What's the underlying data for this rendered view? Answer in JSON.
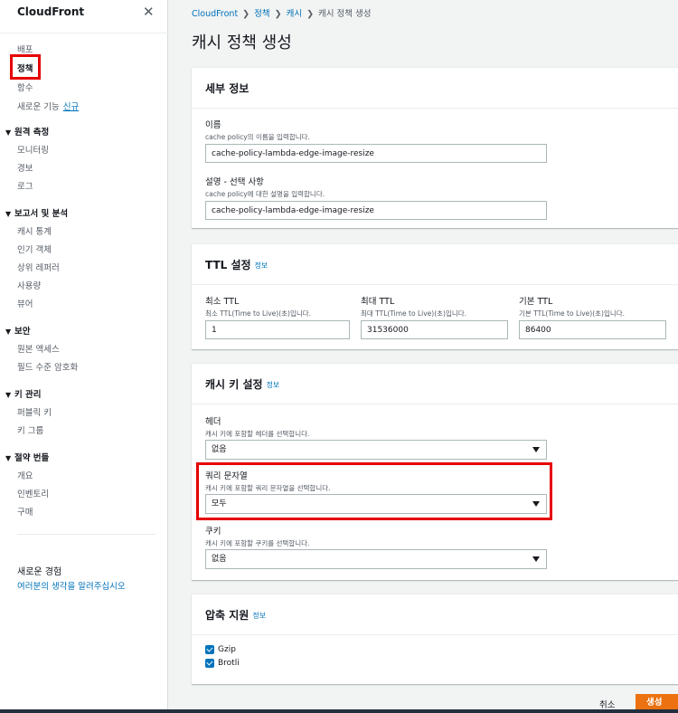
{
  "sidebar": {
    "title": "CloudFront",
    "close_icon": "close-icon",
    "items_top": [
      {
        "label": "배포",
        "active": false
      },
      {
        "label": "정책",
        "active": true
      },
      {
        "label": "함수",
        "active": false
      }
    ],
    "new_features": {
      "label": "새로운 기능",
      "badge": "신규"
    },
    "sections": [
      {
        "title": "원격 측정",
        "items": [
          "모니터링",
          "경보",
          "로그"
        ]
      },
      {
        "title": "보고서 및 분석",
        "items": [
          "캐시 통계",
          "인기 객체",
          "상위 레퍼러",
          "사용량",
          "뷰어"
        ]
      },
      {
        "title": "보안",
        "items": [
          "원본 액세스",
          "필드 수준 암호화"
        ]
      },
      {
        "title": "키 관리",
        "items": [
          "퍼블릭 키",
          "키 그룹"
        ]
      },
      {
        "title": "절약 번들",
        "items": [
          "개요",
          "인벤토리",
          "구매"
        ]
      }
    ],
    "feedback": {
      "title": "새로운 경험",
      "link": "여러분의 생각을 알려주십시오"
    }
  },
  "breadcrumb": [
    "CloudFront",
    "정책",
    "캐시",
    "캐시 정책 생성"
  ],
  "page_title": "캐시 정책 생성",
  "details": {
    "title": "세부 정보",
    "name_label": "이름",
    "name_desc": "cache policy의 이름을 입력합니다.",
    "name_value": "cache-policy-lambda-edge-image-resize",
    "desc_label": "설명 - 선택 사항",
    "desc_desc": "cache policy에 대한 설명을 입력합니다.",
    "desc_value": "cache-policy-lambda-edge-image-resize"
  },
  "ttl": {
    "title": "TTL 설정",
    "info": "정보",
    "min_label": "최소 TTL",
    "min_desc": "최소 TTL(Time to Live)(초)입니다.",
    "min_value": "1",
    "max_label": "최대 TTL",
    "max_desc": "최대 TTL(Time to Live)(초)입니다.",
    "max_value": "31536000",
    "default_label": "기본 TTL",
    "default_desc": "기본 TTL(Time to Live)(초)입니다.",
    "default_value": "86400"
  },
  "cache_key": {
    "title": "캐시 키 설정",
    "info": "정보",
    "header_label": "헤더",
    "header_desc": "캐시 키에 포함할 헤더를 선택합니다.",
    "header_value": "없음",
    "query_label": "쿼리 문자열",
    "query_desc": "캐시 키에 포함할 쿼리 문자열을 선택합니다.",
    "query_value": "모두",
    "cookie_label": "쿠키",
    "cookie_desc": "캐시 키에 포함할 쿠키를 선택합니다.",
    "cookie_value": "없음"
  },
  "compression": {
    "title": "압축 지원",
    "info": "정보",
    "options": [
      "Gzip",
      "Brotli"
    ]
  },
  "footer": {
    "cancel": "취소",
    "create": "생성"
  },
  "colors": {
    "accent": "#0073bb",
    "primary_button": "#ec7211",
    "highlight": "#e60000"
  }
}
